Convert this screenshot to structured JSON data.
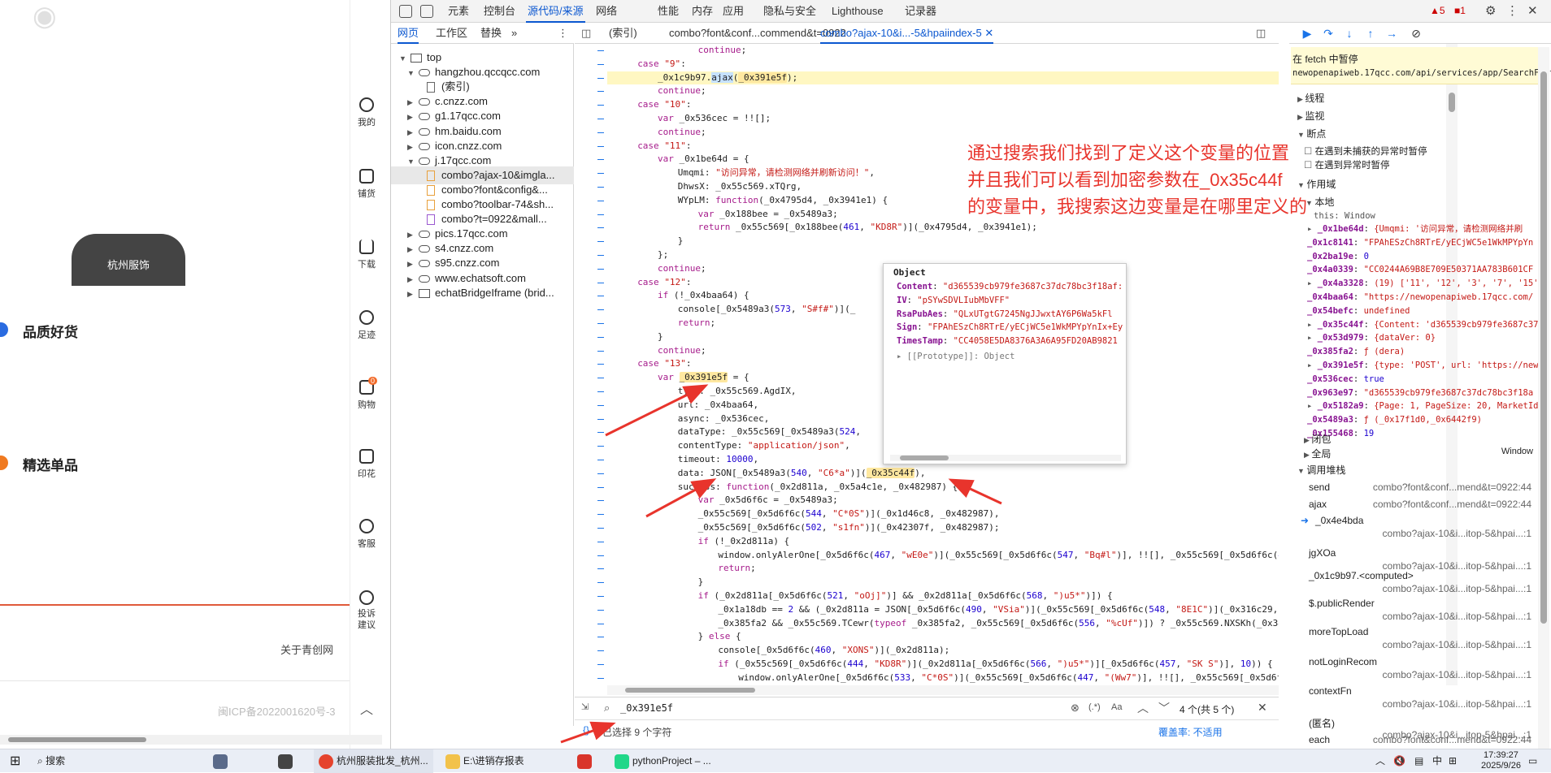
{
  "left_page": {
    "banner": "杭州服饰",
    "section1": "品质好货",
    "section2": "精选单品",
    "about": "关于青创网",
    "icp": "闽ICP备2022001620号-3",
    "rail": [
      {
        "label": "我的"
      },
      {
        "label": "铺货"
      },
      {
        "label": "下载"
      },
      {
        "label": "足迹"
      },
      {
        "label": "购物",
        "badge": "0"
      },
      {
        "label": "印花"
      },
      {
        "label": "客服"
      },
      {
        "label": "投诉建议"
      }
    ]
  },
  "devtools": {
    "tabs": [
      "元素",
      "控制台",
      "源代码/来源",
      "网络",
      "性能",
      "内存",
      "应用",
      "隐私与安全",
      "Lighthouse",
      "记录器"
    ],
    "active_tab": "源代码/来源",
    "warnings": "5",
    "errors": "1",
    "navigator_tabs": [
      "网页",
      "工作区",
      "替换"
    ],
    "tree": [
      {
        "label": "top",
        "indent": 0,
        "type": "frame",
        "open": true
      },
      {
        "label": "hangzhou.qccqcc.com",
        "indent": 1,
        "type": "cloud",
        "open": true
      },
      {
        "label": "(索引)",
        "indent": 2,
        "type": "doc"
      },
      {
        "label": "c.cnzz.com",
        "indent": 1,
        "type": "cloud"
      },
      {
        "label": "g1.17qcc.com",
        "indent": 1,
        "type": "cloud"
      },
      {
        "label": "hm.baidu.com",
        "indent": 1,
        "type": "cloud"
      },
      {
        "label": "icon.cnzz.com",
        "indent": 1,
        "type": "cloud"
      },
      {
        "label": "j.17qcc.com",
        "indent": 1,
        "type": "cloud",
        "open": true
      },
      {
        "label": "combo?ajax-10&imgla...",
        "indent": 2,
        "type": "js",
        "selected": true
      },
      {
        "label": "combo?font&config&...",
        "indent": 2,
        "type": "js"
      },
      {
        "label": "combo?toolbar-74&sh...",
        "indent": 2,
        "type": "js"
      },
      {
        "label": "combo?t=0922&mall...",
        "indent": 2,
        "type": "docp"
      },
      {
        "label": "pics.17qcc.com",
        "indent": 1,
        "type": "cloud"
      },
      {
        "label": "s4.cnzz.com",
        "indent": 1,
        "type": "cloud"
      },
      {
        "label": "s95.cnzz.com",
        "indent": 1,
        "type": "cloud"
      },
      {
        "label": "www.echatsoft.com",
        "indent": 1,
        "type": "cloud"
      },
      {
        "label": "echatBridgeIframe (brid...",
        "indent": 1,
        "type": "frame"
      }
    ],
    "editor_tabs": [
      "(索引)",
      "combo?font&conf...commend&t=0922",
      "combo?ajax-10&i...-5&hpaiindex-5"
    ],
    "search_query": "_0x391e5f",
    "search_result": "4 个(共 5 个)",
    "selection_status": "已选择 9 个字符",
    "coverage": "覆盖率: 不适用",
    "popover": {
      "title": "Object",
      "rows": [
        {
          "key": "Content",
          "val": "\"d365539cb979fe3687c37dc78bc3f18af:"
        },
        {
          "key": "IV",
          "val": "\"pSYwSDVLIubMbVFF\""
        },
        {
          "key": "RsaPubAes",
          "val": "\"QLxUTgtG7245NgJJwxtAY6P6Wa5kFl"
        },
        {
          "key": "Sign",
          "val": "\"FPAhESzCh8RTrE/yECjWC5e1WkMPYpYnIx+Ey"
        },
        {
          "key": "TimesTamp",
          "val": "\"CC4058E5DA8376A3A6A95FD20AB9821"
        }
      ],
      "proto": "[[Prototype]]: Object"
    },
    "paused": "在 fetch 中暂停",
    "paused_url": "newopenapiweb.17qcc.com/api/services/app/SearchFactor",
    "dbg_sections": [
      "线程",
      "监视",
      "断点"
    ],
    "break_opts": [
      "在遇到未捕获的异常时暂停",
      "在遇到异常时暂停"
    ],
    "scope_title": "作用域",
    "scope_local": "本地",
    "scope_this": "this: Window",
    "scope": [
      {
        "k": "_0x1be64d",
        "v": "{Umqmi: '访问异常，请检测网络并刷"
      },
      {
        "k": "_0x1c8141",
        "v": "\"FPAhESzCh8RTrE/yECjWC5e1WkMPYpYn"
      },
      {
        "k": "_0x2ba19e",
        "v": "0"
      },
      {
        "k": "_0x4a0339",
        "v": "\"CC0244A69B8E709E50371AA783B601CF"
      },
      {
        "k": "_0x4a3328",
        "v": "(19) ['11', '12', '3', '7', '15'"
      },
      {
        "k": "_0x4baa64",
        "v": "\"https://newopenapiweb.17qcc.com/"
      },
      {
        "k": "_0x54befc",
        "v": "undefined"
      },
      {
        "k": "_0x35c44f",
        "v": "{Content: 'd365539cb979fe3687c37d"
      },
      {
        "k": "_0x53d979",
        "v": "{dataVer: 0}"
      },
      {
        "k": "_0x385fa2",
        "v": "ƒ (dera)"
      },
      {
        "k": "_0x391e5f",
        "v": "{type: 'POST', url: 'https://newo"
      },
      {
        "k": "_0x536cec",
        "v": "true"
      },
      {
        "k": "_0x963e97",
        "v": "\"d365539cb979fe3687c37dc78bc3f18a"
      },
      {
        "k": "_0x5182a9",
        "v": "{Page: 1, PageSize: 20, MarketIds"
      },
      {
        "k": "_0x5489a3",
        "v": "ƒ (_0x17f1d0,_0x6442f9)"
      },
      {
        "k": "_0x155468",
        "v": "19"
      }
    ],
    "closure": "闭包",
    "global": "全局",
    "global_val": "Window",
    "callstack_title": "调用堆栈",
    "callstack": [
      {
        "name": "send",
        "loc": "combo?font&conf...mend&t=0922:44"
      },
      {
        "name": "ajax",
        "loc": "combo?font&conf...mend&t=0922:44"
      },
      {
        "name": "_0x4e4bda",
        "loc": "combo?ajax-10&i...itop-5&hpai...:1",
        "current": true
      },
      {
        "name": "jgXOa",
        "loc": "combo?ajax-10&i...itop-5&hpai...:1"
      },
      {
        "name": "_0x1c9b97.<computed>",
        "loc": "combo?ajax-10&i...itop-5&hpai...:1"
      },
      {
        "name": "$.publicRender",
        "loc": "combo?ajax-10&i...itop-5&hpai...:1"
      },
      {
        "name": "moreTopLoad",
        "loc": "combo?ajax-10&i...itop-5&hpai...:1"
      },
      {
        "name": "notLoginRecom",
        "loc": "combo?ajax-10&i...itop-5&hpai...:1"
      },
      {
        "name": "contextFn",
        "loc": "combo?ajax-10&i...itop-5&hpai...:1"
      },
      {
        "name": "(匿名)",
        "loc": "combo?ajax-10&i...itop-5&hpai...:1"
      },
      {
        "name": "each",
        "loc": "combo?font&conf...mend&t=0922:44"
      }
    ]
  },
  "annotation": {
    "lines": [
      "通过搜索我们找到了定义这个变量的位置",
      "并且我们可以看到加密参数在_0x35c44f",
      "的变量中，我搜索这边变量是在哪里定义的"
    ]
  },
  "taskbar": {
    "search": "搜索",
    "chrome": "杭州服装批发_杭州...",
    "folder": "E:\\进销存报表",
    "pycharm": "pythonProject – ...",
    "ime": "中",
    "time": "17:39:27",
    "date": "2025/9/26"
  }
}
